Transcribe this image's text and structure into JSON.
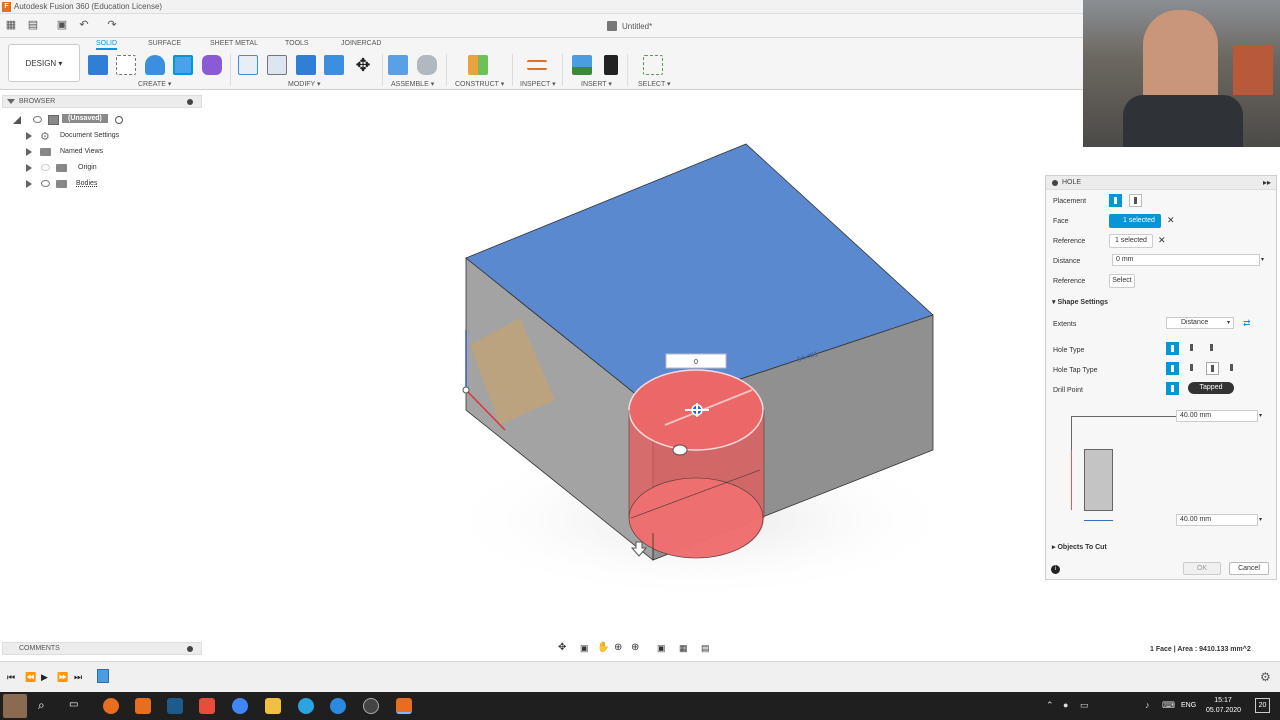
{
  "window": {
    "title": "Autodesk Fusion 360 (Education License)",
    "app_letter": "F"
  },
  "document": {
    "title": "Untitled*"
  },
  "ribbon": {
    "workspace": "DESIGN",
    "tabs": [
      "SOLID",
      "SURFACE",
      "SHEET METAL",
      "TOOLS",
      "JOINERCAD"
    ],
    "active_tab": "SOLID",
    "groups": [
      "CREATE",
      "MODIFY",
      "ASSEMBLE",
      "CONSTRUCT",
      "INSPECT",
      "INSERT",
      "SELECT"
    ]
  },
  "browser": {
    "title": "BROWSER",
    "items": [
      "(Unsaved)",
      "Document Settings",
      "Named Views",
      "Origin",
      "Bodies"
    ]
  },
  "viewport": {
    "value_box": "0",
    "dimension_label": "94.481"
  },
  "hole_panel": {
    "title": "HOLE",
    "placement_label": "Placement",
    "face_label": "Face",
    "face_value": "1 selected",
    "reference1_label": "Reference",
    "reference1_value": "1 selected",
    "distance_label": "Distance",
    "distance_value": "0 mm",
    "reference2_label": "Reference",
    "reference2_value": "Select",
    "shape_settings_label": "Shape Settings",
    "extents_label": "Extents",
    "extents_value": "Distance",
    "hole_type_label": "Hole Type",
    "hole_tap_type_label": "Hole Tap Type",
    "drill_point_label": "Drill Point",
    "tooltip": "Tapped",
    "depth_value": "40.00 mm",
    "diameter_value": "40.00 mm",
    "objects_to_cut_label": "Objects To Cut",
    "ok_label": "OK",
    "cancel_label": "Cancel"
  },
  "comments": {
    "title": "COMMENTS"
  },
  "status": {
    "selection_info": "1 Face | Area : 9410.133 mm^2"
  },
  "taskbar": {
    "language": "ENG",
    "time": "15:17",
    "date": "05.07.2020",
    "notification_count": "20"
  },
  "colors": {
    "accent": "#0696d7",
    "model_top": "#5b89d0",
    "model_side": "#9a9a9a",
    "hole_red": "#e8595a"
  }
}
